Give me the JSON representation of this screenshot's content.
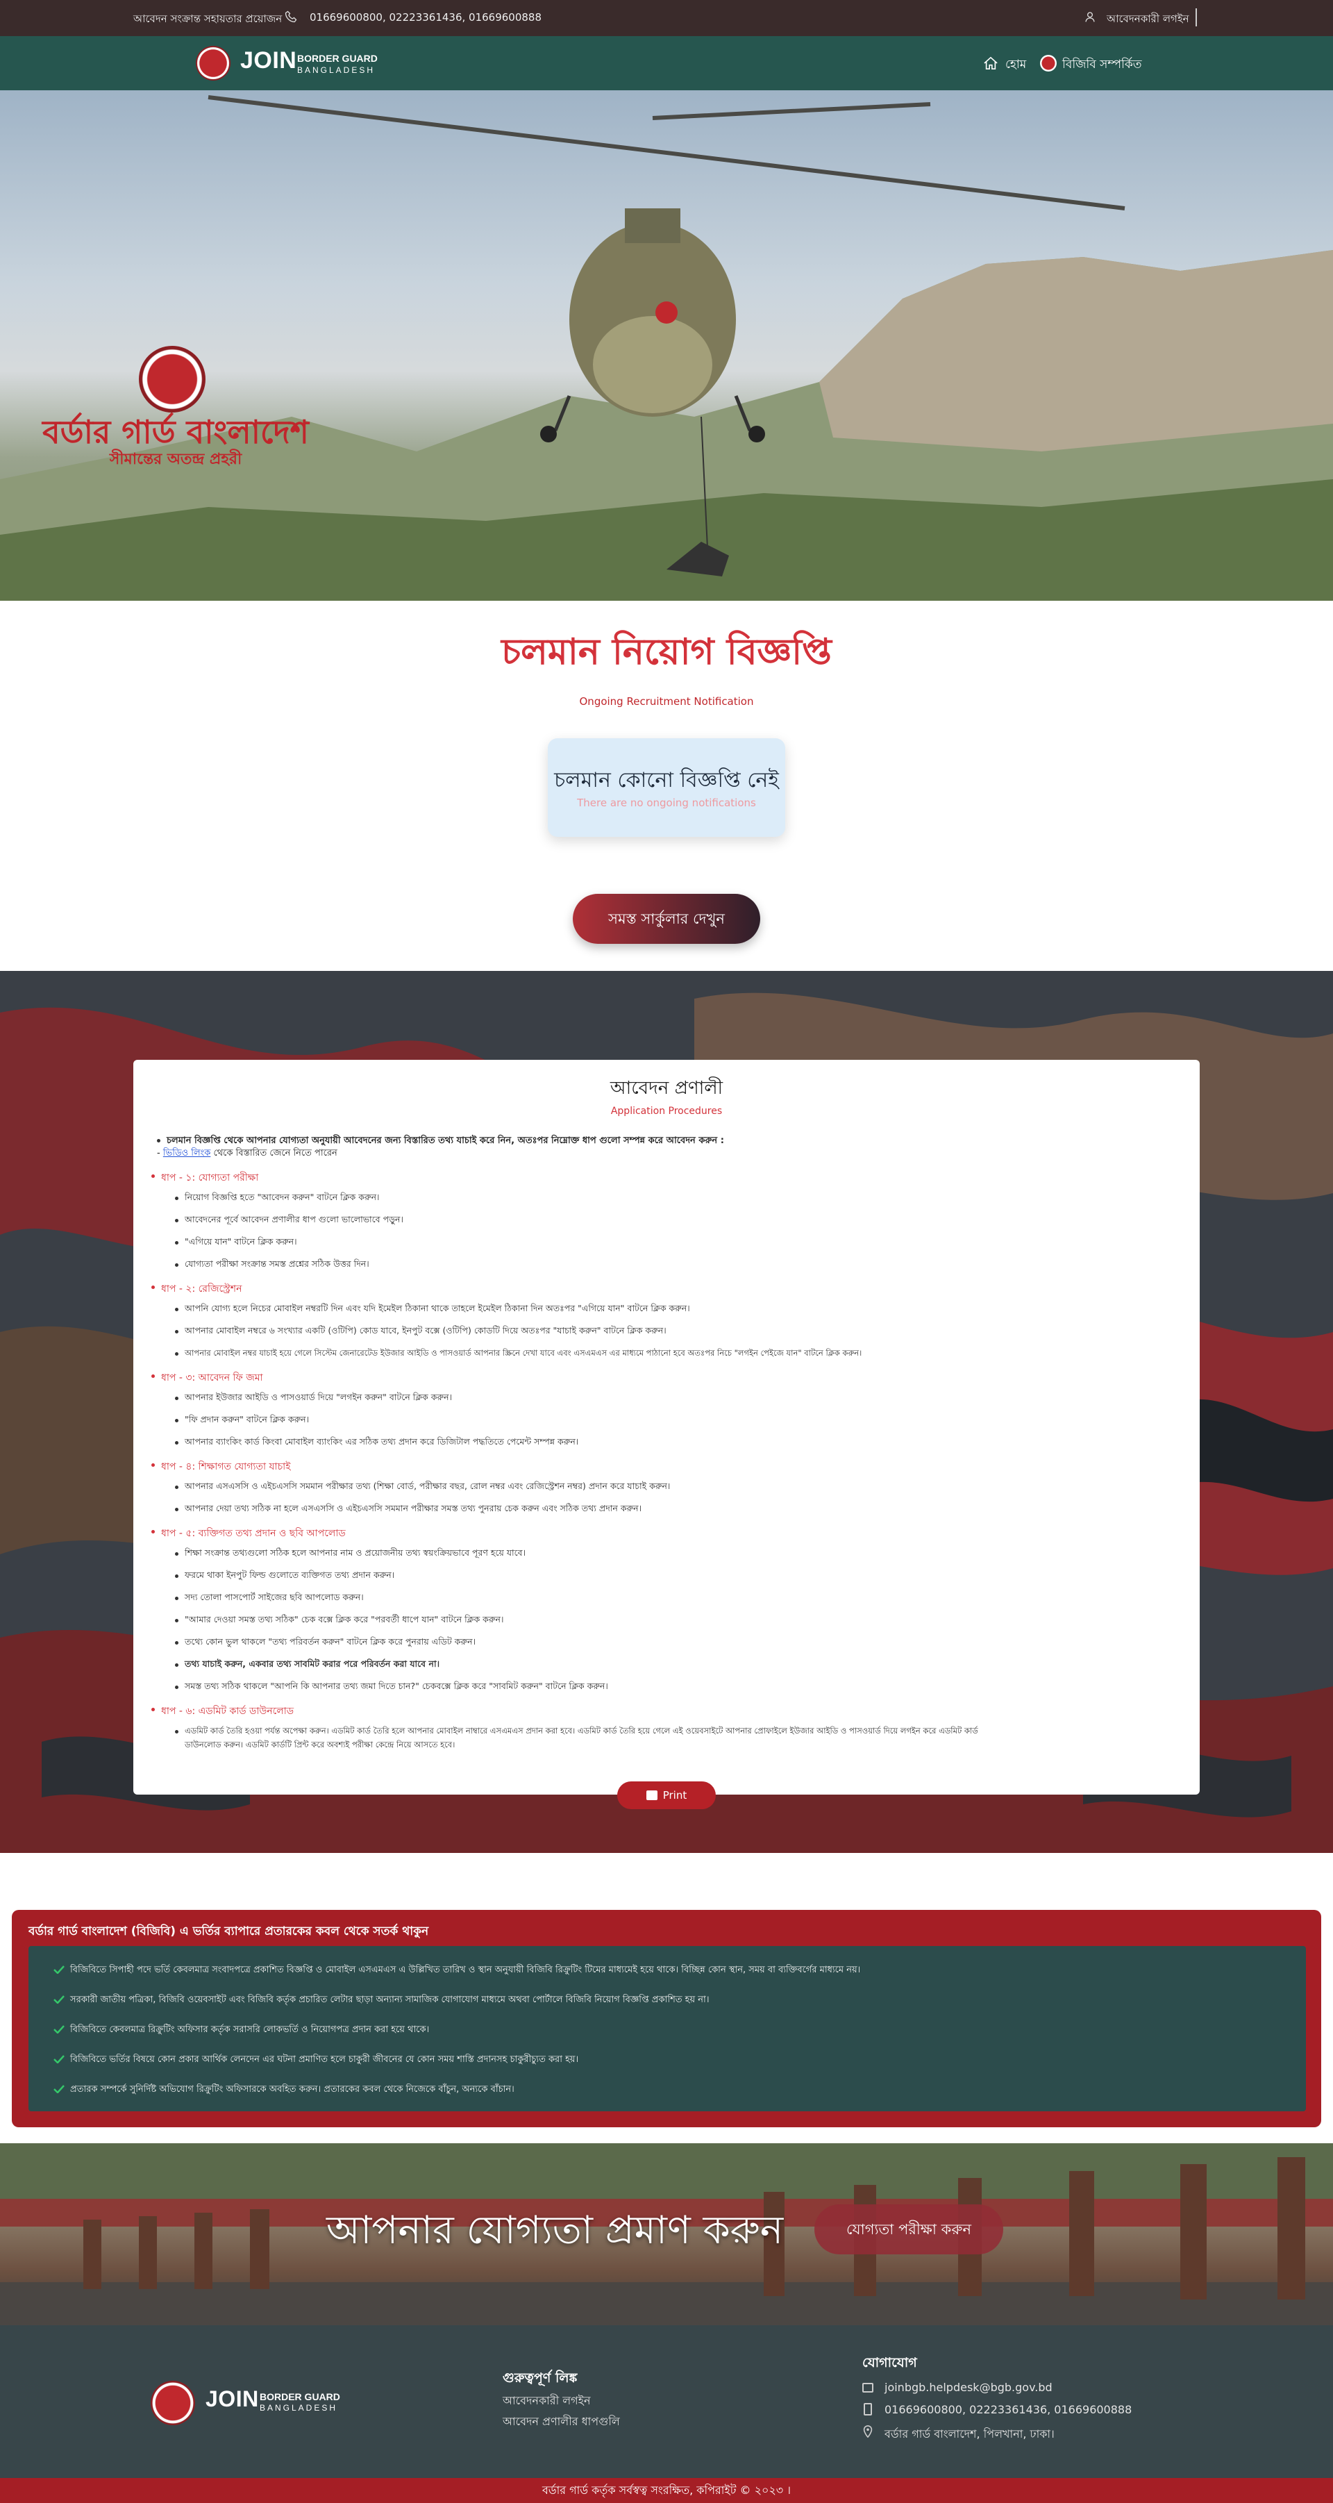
{
  "topbar": {
    "help": "আবেদন সংক্রান্ত সহায়তার প্রয়োজন",
    "phones": "01669600800, 02223361436, 01669600888",
    "login": "আবেদনকারী লগইন"
  },
  "nav": {
    "logo_join": "JOIN",
    "logo_line1": "BORDER GUARD",
    "logo_line2": "BANGLADESH",
    "home": "হোম",
    "about": "বিজিবি সম্পর্কিত"
  },
  "hero": {
    "title": "বর্ডার গার্ড বাংলাদেশ",
    "tagline": "সীমান্তের অতন্দ্র প্রহরী"
  },
  "ongoing": {
    "title": "চলমান নিয়োগ বিজ্ঞপ্তি",
    "subtitle": "Ongoing Recruitment Notification",
    "empty_bn": "চলমান কোনো বিজ্ঞপ্তি নেই",
    "empty_en": "There are no ongoing notifications",
    "all_button": "সমস্ত সার্কুলার দেখুন"
  },
  "procedure": {
    "title": "আবেদন প্রণালী",
    "subtitle": "Application Procedures",
    "intro": "চলমান বিজ্ঞপ্তি থেকে আপনার যোগ্যতা অনুযায়ী আবেদনের জন্য বিস্তারিত তথ্য যাচাই করে নিন, অতঃপর নিম্নোক্ত ধাপ গুলো সম্পন্ন করে আবেদন করুন :",
    "video_link": "ভিডিও লিংক",
    "video_rest": " থেকে বিস্তারিত জেনে নিতে পারেন",
    "steps": [
      {
        "title": "ধাপ - ১: যোগ্যতা পরীক্ষা",
        "items": [
          "নিয়োগ বিজ্ঞপ্তি হতে \"আবেদন করুন\" বাটনে ক্লিক করুন।",
          "আবেদনের পূর্বে আবেদন প্রণালীর ধাপ গুলো ভালোভাবে পড়ুন।",
          "\"এগিয়ে যান\" বাটনে ক্লিক করুন।",
          "যোগ্যতা পরীক্ষা সংক্রান্ত সমস্ত প্রশ্নের সঠিক উত্তর দিন।"
        ]
      },
      {
        "title": "ধাপ - ২: রেজিস্ট্রেশন",
        "items": [
          "আপনি যোগ্য হলে নিচের মোবাইল নম্বরটি দিন এবং যদি ইমেইল ঠিকানা থাকে তাহলে ইমেইল ঠিকানা দিন অতঃপর \"এগিয়ে যান\" বাটনে ক্লিক করুন।",
          "আপনার মোবাইল নম্বরে ৬ সংখ্যার একটি (ওটিপি) কোড যাবে, ইনপুট বক্সে (ওটিপি) কোডটি দিয়ে অতঃপর \"যাচাই করুন\" বাটনে ক্লিক করুন।",
          "আপনার মোবাইল নম্বর যাচাই হয়ে গেলে সিস্টেম জেনারেটেড ইউজার আইডি ও পাসওয়ার্ড আপনার স্ক্রিনে দেখা যাবে এবং এসএমএস এর মাধ্যমে পাঠানো হবে অতঃপর নিচে \"লগইন পেইজে যান\" বাটনে ক্লিক করুন।"
        ]
      },
      {
        "title": "ধাপ - ৩: আবেদন ফি জমা",
        "items": [
          "আপনার ইউজার আইডি ও পাসওয়ার্ড দিয়ে \"লগইন করুন\" বাটনে ক্লিক করুন।",
          "\"ফি প্রদান করুন\" বাটনে ক্লিক করুন।",
          "আপনার ব্যাংকিং কার্ড কিংবা মোবাইল ব্যাংকিং এর সঠিক তথ্য প্রদান করে ডিজিটাল পদ্ধতিতে পেমেন্ট সম্পন্ন করুন।"
        ]
      },
      {
        "title": "ধাপ - ৪: শিক্ষাগত যোগ্যতা যাচাই",
        "items": [
          "আপনার এসএসসি ও এইচএসসি সমমান পরীক্ষার তথ্য (শিক্ষা বোর্ড, পরীক্ষার বছর, রোল নম্বর এবং রেজিস্ট্রেশন নম্বর) প্রদান করে যাচাই করুন।",
          "আপনার দেয়া তথ্য সঠিক না হলে এসএসসি ও এইচএসসি সমমান পরীক্ষার সমস্ত তথ্য পুনরায় চেক করুন এবং সঠিক তথ্য প্রদান করুন।"
        ]
      },
      {
        "title": "ধাপ - ৫: ব্যক্তিগত তথ্য প্রদান ও ছবি আপলোড",
        "items": [
          "শিক্ষা সংক্রান্ত তথ্যগুলো সঠিক হলে আপনার নাম ও প্রয়োজনীয় তথ্য স্বয়ংক্রিয়ভাবে পূরণ হয়ে যাবে।",
          "ফরমে থাকা ইনপুট ফিল্ড গুলোতে ব্যক্তিগত তথ্য প্রদান করুন।",
          "সদ্য তোলা পাসপোর্ট সাইজের ছবি আপলোড করুন।",
          "\"আমার দেওয়া সমস্ত তথ্য সঠিক\" চেক বক্সে ক্লিক করে \"পরবর্তী ধাপে যান\" বাটনে ক্লিক করুন।",
          "তথ্যে কোন ভুল থাকলে \"তথ্য পরিবর্তন করুন\" বাটনে ক্লিক করে পুনরায় এডিট করুন।",
          "তথ্য যাচাই করুন, একবার তথ্য সাবমিট করার পরে পরিবর্তন করা যাবে না।",
          "সমস্ত তথ্য সঠিক থাকলে \"আপনি কি আপনার তথ্য জমা দিতে চান?\" চেকবক্সে ক্লিক করে \"সাবমিট করুন\" বাটনে ক্লিক করুন।"
        ]
      },
      {
        "title": "ধাপ - ৬: এডমিট কার্ড ডাউনলোড",
        "items": [
          "এডমিট কার্ড তৈরি হওয়া পর্যন্ত অপেক্ষা করুন। এডমিট কার্ড তৈরি হলে আপনার মোবাইল নাম্বারে এসএমএস প্রদান করা হবে। এডমিট কার্ড তৈরি হয়ে গেলে এই ওয়েবসাইটে আপনার প্রোফাইলে ইউজার আইডি ও পাসওয়ার্ড দিয়ে লগইন করে এডমিট কার্ড",
          "ডাউনলোড করুন। এডমিট কার্ডটি প্রিন্ট করে অবশ্যই পরীক্ষা কেন্দ্রে নিয়ে আসতে হবে।"
        ]
      }
    ],
    "print": "Print"
  },
  "warning": {
    "title": "বর্ডার গার্ড বাংলাদেশ (বিজিবি) এ ভর্তির ব্যাপারে প্রতারকের কবল থেকে সতর্ক থাকুন",
    "items": [
      "বিজিবিতে সিপাহী পদে ভর্তি কেবলমাত্র সংবাদপত্রে প্রকাশিত বিজ্ঞপ্তি ও মোবাইল এসএমএস এ উল্লিখিত তারিখ ও স্থান অনুযায়ী বিজিবি রিক্রুটিং টিমের মাধ্যমেই হয়ে থাকে। বিচ্ছিন্ন কোন স্থান, সময় বা ব্যক্তিবর্গের মাধ্যমে নয়।",
      "সরকারী জাতীয় পত্রিকা, বিজিবি ওয়েবসাইট এবং বিজিবি কর্তৃক প্রচারিত লেটার ছাড়া অন্যান্য সামাজিক যোগাযোগ মাধ্যমে অথবা পোর্টালে বিজিবি নিয়োগ বিজ্ঞপ্তি প্রকাশিত হয় না।",
      "বিজিবিতে কেবলমাত্র রিক্রুটিং অফিসার কর্তৃক সরাসরি লোকভর্তি ও নিয়োগপত্র প্রদান করা হয়ে থাকে।",
      "বিজিবিতে ভর্তির বিষয়ে কোন প্রকার আর্থিক লেনদেন এর ঘটনা প্রমাণিত হলে চাকুরী জীবনের যে কোন সময় শাস্তি প্রদানসহ চাকুরীচ্যুত করা হয়।",
      "প্রতারক সম্পর্কে সুনির্দিষ্ট অভিযোগ রিক্রুটিং অফিসারকে অবহিত করুন। প্রতারকের কবল থেকে নিজেকে বাঁচুন, অন্যকে বাঁচান।"
    ]
  },
  "banner": {
    "title": "আপনার যোগ্যতা প্রমাণ করুন",
    "button": "যোগ্যতা পরীক্ষা করুন"
  },
  "footer": {
    "links_title": "গুরুত্বপূর্ণ লিঙ্ক",
    "links": [
      "আবেদনকারী লগইন",
      "আবেদন প্রণালীর ধাপগুলি"
    ],
    "contact_title": "যোগাযোগ",
    "email": "joinbgb.helpdesk@bgb.gov.bd",
    "phones": "01669600800, 02223361436, 01669600888",
    "address": "বর্ডার গার্ড বাংলাদেশ, পিলখানা, ঢাকা।",
    "copyright": "বর্ডার গার্ড কর্তৃক সর্বস্বত্ব সংরক্ষিত, কপিরাইট © ২০২৩ ।"
  },
  "colors": {
    "brand_green": "#26564f",
    "brand_red": "#a51e25",
    "accent_red": "#d3323a"
  },
  "icons": [
    "phone-icon",
    "user-icon",
    "home-icon",
    "bgb-emblem-icon",
    "print-icon",
    "check-icon",
    "email-icon",
    "mobile-icon",
    "location-icon"
  ]
}
